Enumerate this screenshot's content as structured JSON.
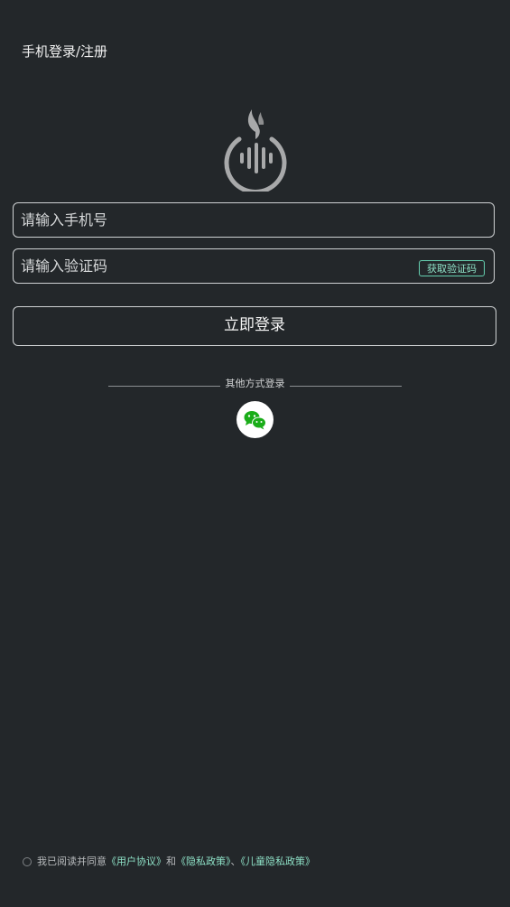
{
  "header": {
    "title": "手机登录/注册"
  },
  "logo": {
    "icon": "flame-voice-logo-icon",
    "color": "#a8a9aa"
  },
  "form": {
    "phone_placeholder": "请输入手机号",
    "code_placeholder": "请输入验证码",
    "get_code_label": "获取验证码",
    "login_label": "立即登录"
  },
  "other_login": {
    "label": "其他方式登录",
    "wechat_icon": "wechat-icon",
    "wechat_color": "#1aad19"
  },
  "agreement": {
    "prefix": "我已阅读并同意",
    "user_agreement": "《用户协议》",
    "and": "和",
    "privacy_policy": "《隐私政策》",
    "separator": "、",
    "child_privacy_policy": "《儿童隐私政策》"
  },
  "colors": {
    "background": "#23272a",
    "accent": "#66d1b1",
    "border": "#cfd2d4"
  }
}
